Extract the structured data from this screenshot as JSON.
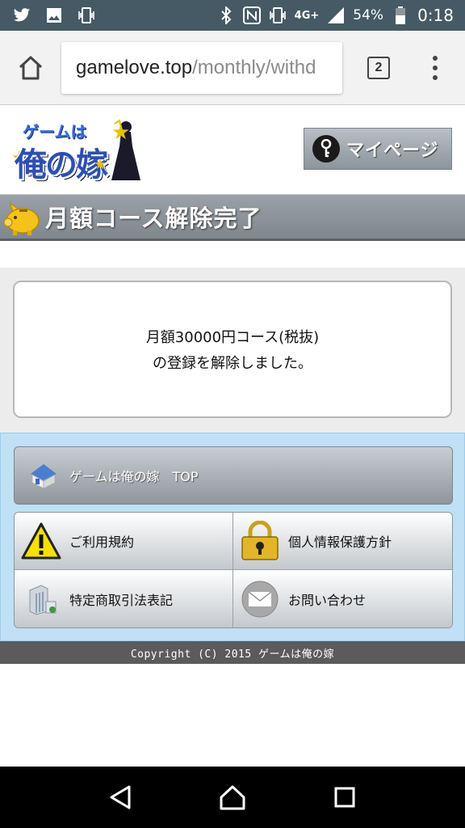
{
  "status_bar": {
    "network": "4G+",
    "battery": "54%",
    "time": "0:18",
    "icons": [
      "twitter-icon",
      "image-icon",
      "vibrate-icon",
      "bluetooth-icon",
      "nfc-icon",
      "vibrate-icon",
      "signal-icon",
      "battery-icon"
    ]
  },
  "browser": {
    "url_host": "gamelove.top",
    "url_path": "/monthly/withd",
    "tab_count": "2"
  },
  "header": {
    "logo_small": "ゲームは",
    "logo_big": "俺の嫁",
    "mypage_label": "マイページ"
  },
  "page": {
    "title": "月額コース解除完了",
    "message_line1": "月額30000円コース(税抜)",
    "message_line2": "の登録を解除しました。"
  },
  "nav": {
    "top_label": "ゲームは俺の嫁　TOP",
    "terms_label": "ご利用規約",
    "privacy_label": "個人情報保護方針",
    "commerce_label": "特定商取引法表記",
    "contact_label": "お問い合わせ"
  },
  "footer": {
    "copyright": "Copyright (C) 2015 ゲームは俺の嫁"
  },
  "colors": {
    "status_bar": "#455a64",
    "title_bar": "#8a9198",
    "nav_bg": "#bfe0f5",
    "footer": "#5b5b5b"
  }
}
